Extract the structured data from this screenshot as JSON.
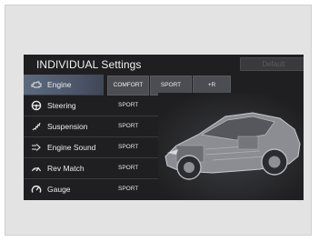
{
  "screen": {
    "title": "INDIVIDUAL Settings",
    "default_label": "Default"
  },
  "menu": {
    "items": [
      {
        "label": "Engine",
        "value": "",
        "icon": "engine-icon"
      },
      {
        "label": "Steering",
        "value": "SPORT",
        "icon": "steering-wheel-icon"
      },
      {
        "label": "Suspension",
        "value": "SPORT",
        "icon": "suspension-icon"
      },
      {
        "label": "Engine Sound",
        "value": "SPORT",
        "icon": "engine-sound-icon"
      },
      {
        "label": "Rev Match",
        "value": "SPORT",
        "icon": "rev-match-icon"
      },
      {
        "label": "Gauge",
        "value": "SPORT",
        "icon": "gauge-icon"
      }
    ]
  },
  "engine_options": [
    "COMFORT",
    "SPORT",
    "+R"
  ],
  "colors": {
    "screen_bg": "#1f1f21",
    "selected_row": "#5d6a7e",
    "option_bg": "#4c4d52"
  }
}
